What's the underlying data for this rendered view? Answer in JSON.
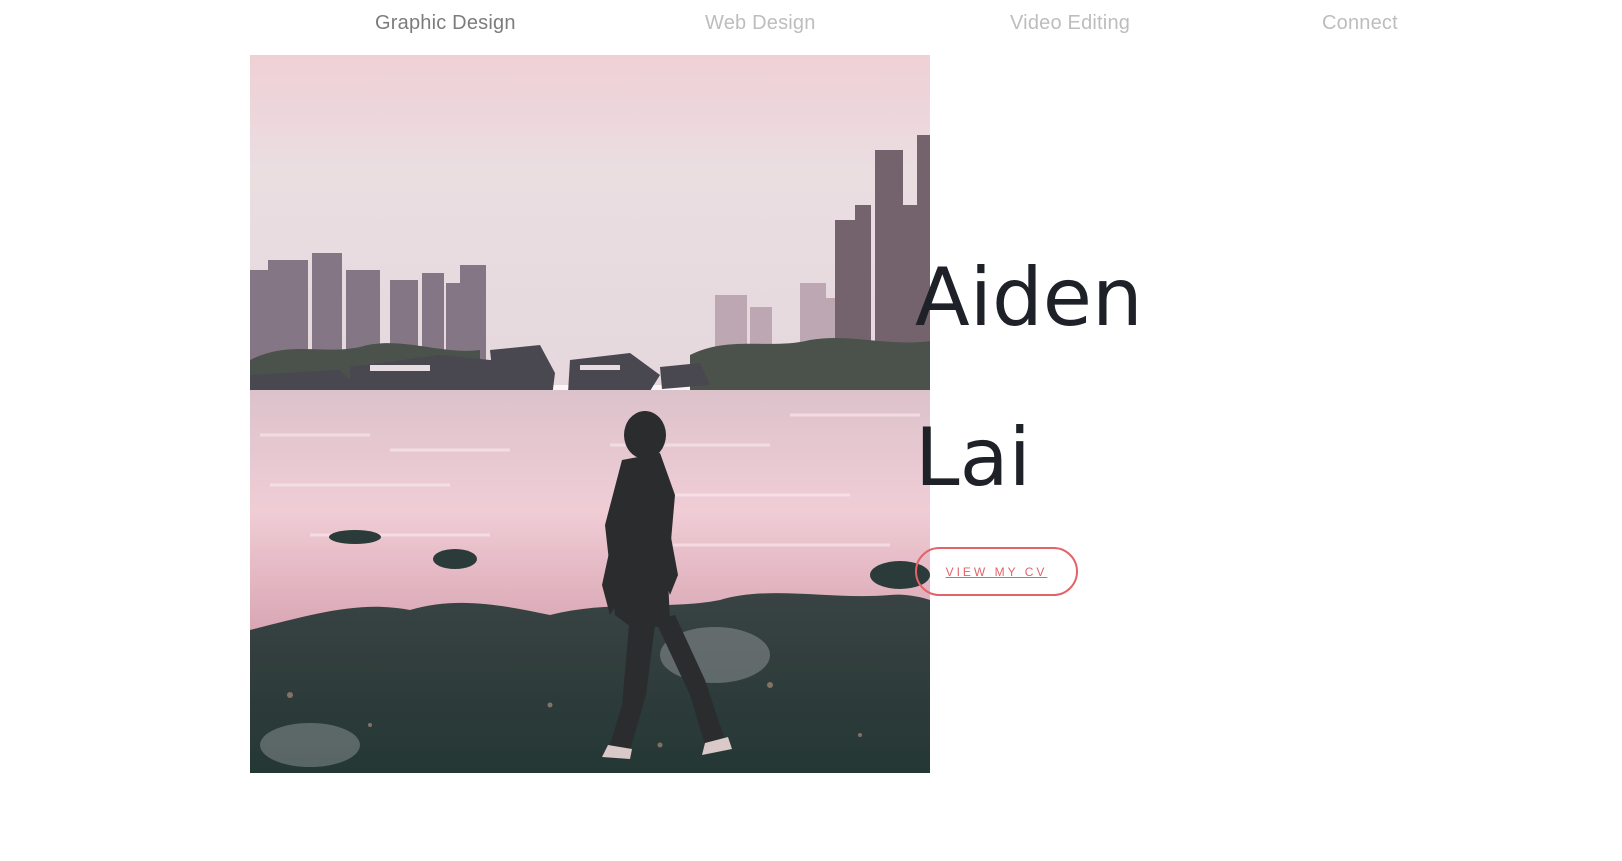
{
  "nav": {
    "items": [
      {
        "label": "Graphic Design"
      },
      {
        "label": "Web Design"
      },
      {
        "label": "Video Editing"
      },
      {
        "label": "Connect"
      }
    ]
  },
  "hero": {
    "first_name": "Aiden",
    "last_name": "Lai",
    "cv_button_label": "VIEW MY CV",
    "photo": {
      "icon": "portrait-photo",
      "palette": {
        "sky": "#ece4e6",
        "sky_top": "#f2d9dc",
        "buildings": "#8a7c86",
        "water": "#e9c8d0",
        "boats": "#3b3f46",
        "rocks": "#1f3a35",
        "figure": "#1c2424"
      }
    }
  },
  "colors": {
    "accent": "#e2636a",
    "name_text": "#1e2128",
    "nav_text": "#7c7c7c",
    "nav_text_muted": "#bdbdbd"
  }
}
